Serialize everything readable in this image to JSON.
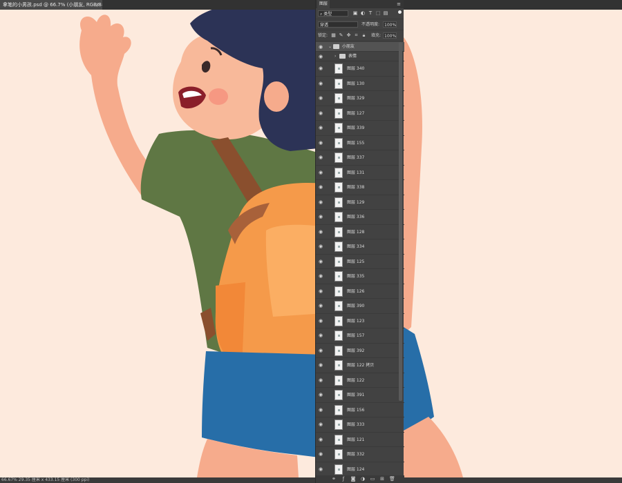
{
  "document": {
    "tab_title": "拿笔的小男孩.psd @ 66.7% (小朋友, RGB/8#) *",
    "close": "×"
  },
  "status_bar": {
    "text": "66.67%  29.35 厘米 x 433.15 厘米 (300 ppi)"
  },
  "panel": {
    "tab_label": "图层",
    "menu_icon": "≡",
    "filter": {
      "kind": "类型",
      "icon": "search-icon"
    },
    "blend_mode": "穿透",
    "opacity_label": "不透明度:",
    "opacity_value": "100%",
    "lock_label": "锁定:",
    "fill_label": "填充:",
    "fill_value": "100%",
    "group": {
      "name": "小朋友",
      "caret": "⌄"
    },
    "subgroup": {
      "name": "表情",
      "caret": "›"
    },
    "layers": [
      "图层 340",
      "图层 130",
      "图层 329",
      "图层 127",
      "图层 339",
      "图层 155",
      "图层 337",
      "图层 131",
      "图层 338",
      "图层 129",
      "图层 336",
      "图层 128",
      "图层 334",
      "图层 125",
      "图层 335",
      "图层 126",
      "图层 390",
      "图层 123",
      "图层 157",
      "图层 392",
      "图层 122 拷贝",
      "图层 122",
      "图层 391",
      "图层 156",
      "图层 333",
      "图层 121",
      "图层 332",
      "图层 124"
    ],
    "footer_icons": [
      "link-icon",
      "fx-icon",
      "mask-icon",
      "adjustment-icon",
      "folder-icon",
      "new-layer-icon",
      "trash-icon"
    ]
  },
  "colors": {
    "canvas_bg": "#fdeadd",
    "hair": "#2c3356",
    "skin": "#f6ab8c",
    "shirt": "#5f7744",
    "shorts": "#276ea8",
    "backpack": "#f59a4a",
    "strap": "#8a4f2e"
  }
}
